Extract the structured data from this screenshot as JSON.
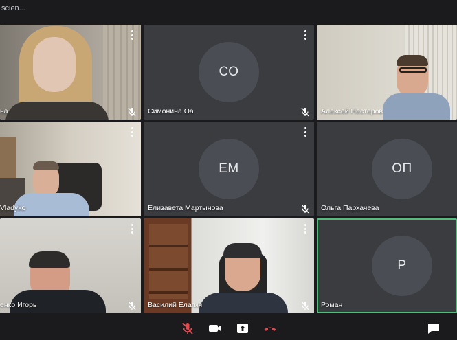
{
  "meeting": {
    "title": "scien..."
  },
  "participants": [
    {
      "name": "на",
      "initials": "",
      "muted": true,
      "video": true
    },
    {
      "name": "Симонина Оа",
      "initials": "СО",
      "muted": true,
      "video": false
    },
    {
      "name": "Алексей Нестеров",
      "initials": "",
      "muted": false,
      "video": true
    },
    {
      "name": "Vladyko",
      "initials": "",
      "muted": false,
      "video": true
    },
    {
      "name": "Елизавета Мартынова",
      "initials": "ЕМ",
      "muted": true,
      "video": false
    },
    {
      "name": "Ольга Пархачева",
      "initials": "ОП",
      "muted": false,
      "video": false
    },
    {
      "name": "енко Игорь",
      "initials": "",
      "muted": true,
      "video": true
    },
    {
      "name": "Василий Елагин",
      "initials": "",
      "muted": true,
      "video": true
    },
    {
      "name": "Роман",
      "initials": "Р",
      "muted": false,
      "video": false,
      "speaking": true
    }
  ],
  "colors": {
    "background": "#1b1b1d",
    "tile": "#3a3c40",
    "avatar": "#4a4d53",
    "active_border": "#4fbf7a",
    "hangup": "#e0494f",
    "mic_off": "#e0494f"
  },
  "controls": [
    {
      "name": "mic-off-icon",
      "state": "muted"
    },
    {
      "name": "camera-icon"
    },
    {
      "name": "share-screen-icon"
    },
    {
      "name": "hang-up-icon"
    },
    {
      "name": "chat-icon"
    }
  ]
}
